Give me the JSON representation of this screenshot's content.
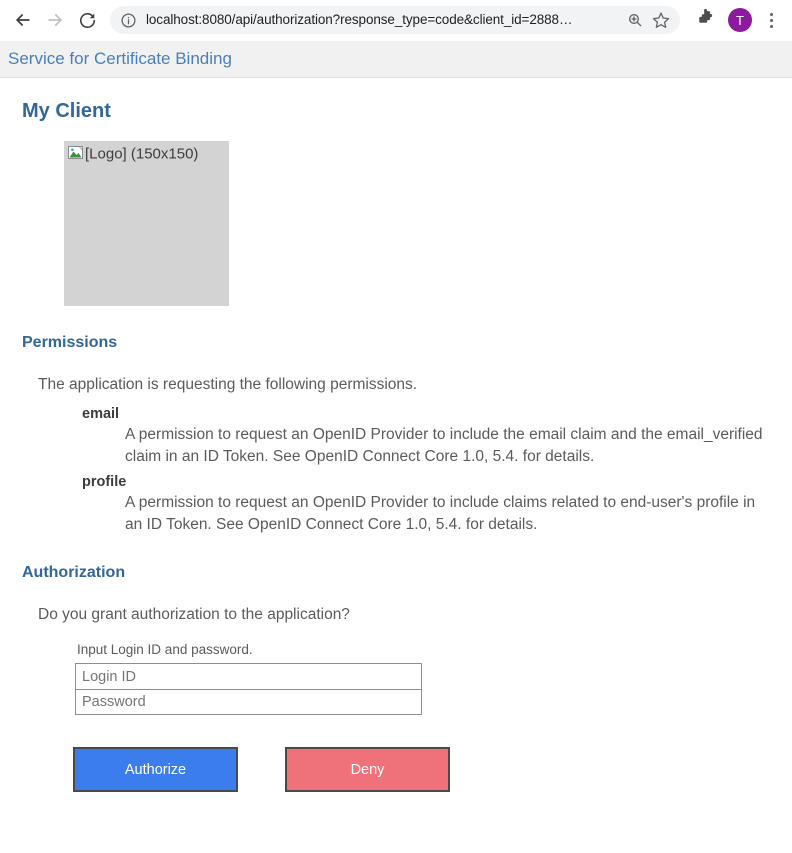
{
  "browser": {
    "back_icon": "arrow-left-icon",
    "forward_icon": "arrow-right-icon",
    "reload_icon": "reload-icon",
    "site_info_icon": "info-circle-icon",
    "url": "localhost:8080/api/authorization?response_type=code&client_id=2888…",
    "url_host": "localhost:8080",
    "url_path": "/api/authorization?response_type=code&client_id=2888…",
    "zoom_icon": "zoom-in-icon",
    "bookmark_icon": "star-icon",
    "extensions_icon": "puzzle-piece-icon",
    "profile_avatar_letter": "T",
    "profile_avatar_color": "#8b1a9e",
    "menu_icon": "three-dot-menu-icon"
  },
  "page": {
    "header_title": "Service for Certificate Binding",
    "header_bg": "#f1f1f1",
    "heading_color": "#336699",
    "client_name": "My Client",
    "logo": {
      "alt_text": "[Logo] (150x150)",
      "icon": "broken-image-icon",
      "placeholder_color": "#d3d3d3"
    },
    "permissions": {
      "title": "Permissions",
      "intro": "The application is requesting the following permissions.",
      "items": [
        {
          "name": "email",
          "description": "A permission to request an OpenID Provider to include the email claim and the email_verified claim in an ID Token. See OpenID Connect Core 1.0, 5.4. for details."
        },
        {
          "name": "profile",
          "description": "A permission to request an OpenID Provider to include claims related to end-user's profile in an ID Token. See OpenID Connect Core 1.0, 5.4. for details."
        }
      ]
    },
    "authorization": {
      "title": "Authorization",
      "prompt": "Do you grant authorization to the application?",
      "login_hint": "Input Login ID and password.",
      "login_id": {
        "placeholder": "Login ID",
        "value": ""
      },
      "password": {
        "placeholder": "Password",
        "value": ""
      },
      "authorize_label": "Authorize",
      "authorize_color": "#3b7ded",
      "deny_label": "Deny",
      "deny_color": "#ef7179"
    }
  }
}
